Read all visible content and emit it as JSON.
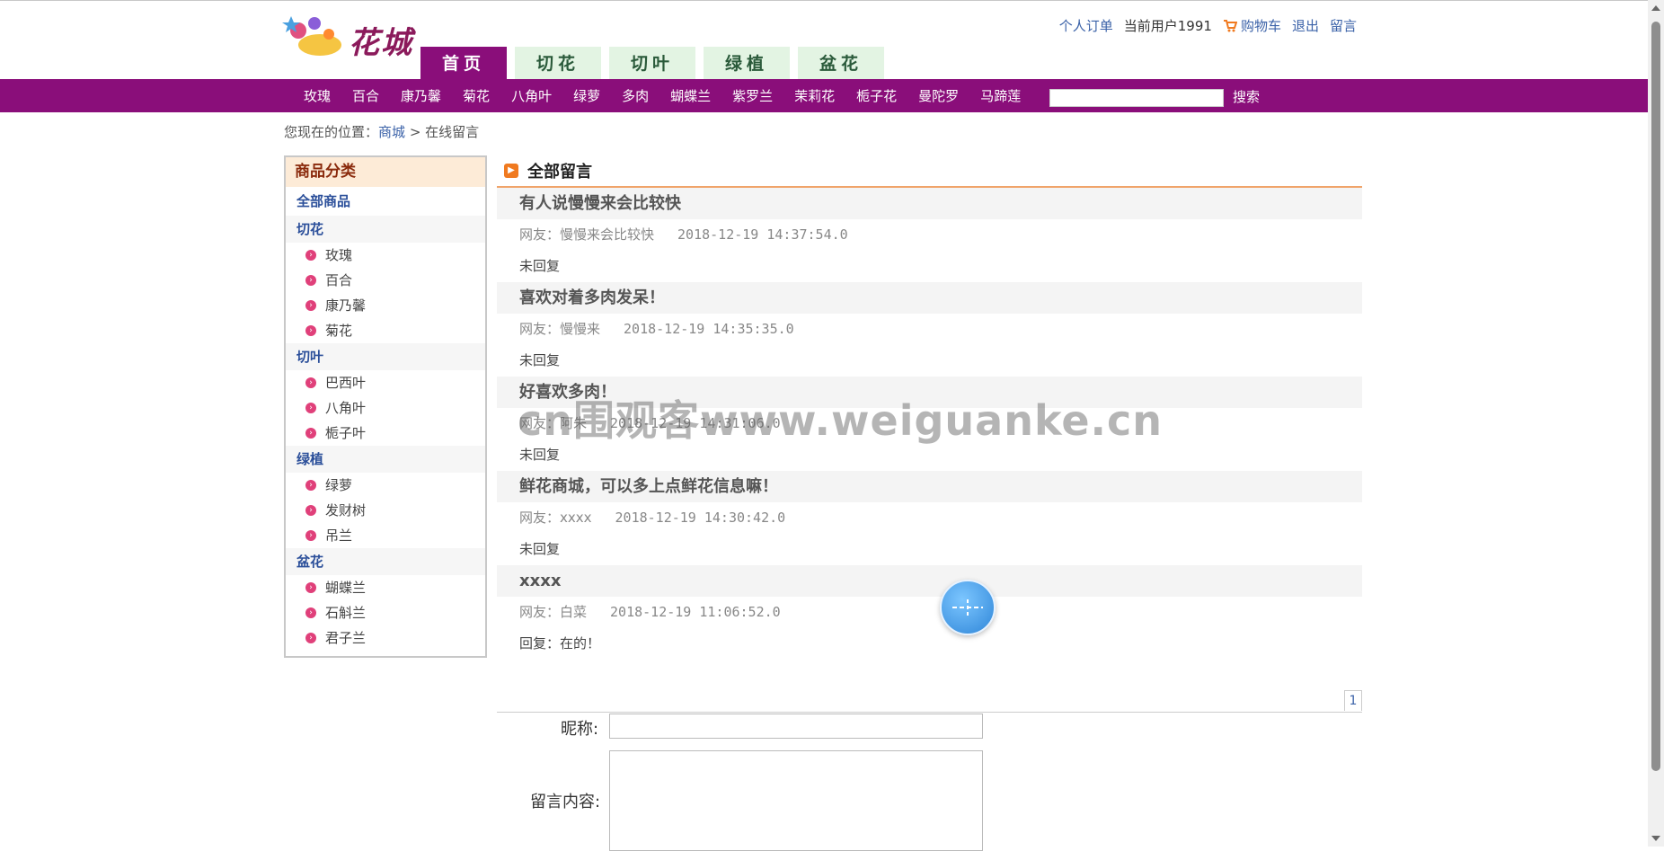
{
  "logo": {
    "text": "花城"
  },
  "userbar": {
    "orders": "个人订单",
    "current_user": "当前用户1991",
    "cart": "购物车",
    "logout": "退出",
    "message": "留言"
  },
  "nav_tabs": [
    {
      "label": "首页",
      "active": true
    },
    {
      "label": "切花",
      "active": false
    },
    {
      "label": "切叶",
      "active": false
    },
    {
      "label": "绿植",
      "active": false
    },
    {
      "label": "盆花",
      "active": false
    }
  ],
  "category_nav": [
    "玫瑰",
    "百合",
    "康乃馨",
    "菊花",
    "八角叶",
    "绿萝",
    "多肉",
    "蝴蝶兰",
    "紫罗兰",
    "茉莉花",
    "栀子花",
    "曼陀罗",
    "马蹄莲"
  ],
  "search": {
    "button": "搜索",
    "value": ""
  },
  "breadcrumb": {
    "prefix": "您现在的位置：",
    "link": "商城",
    "separator": ">",
    "current": "在线留言"
  },
  "sidebar": {
    "title": "商品分类",
    "all": "全部商品",
    "groups": [
      {
        "name": "切花",
        "items": [
          "玫瑰",
          "百合",
          "康乃馨",
          "菊花"
        ]
      },
      {
        "name": "切叶",
        "items": [
          "巴西叶",
          "八角叶",
          "栀子叶"
        ]
      },
      {
        "name": "绿植",
        "items": [
          "绿萝",
          "发财树",
          "吊兰"
        ]
      },
      {
        "name": "盆花",
        "items": [
          "蝴蝶兰",
          "石斛兰",
          "君子兰"
        ]
      }
    ]
  },
  "main": {
    "title": "全部留言",
    "messages": [
      {
        "title": "有人说慢慢来会比较快",
        "user": "网友：慢慢来会比较快",
        "time": "2018-12-19 14:37:54.0",
        "reply": "未回复"
      },
      {
        "title": "喜欢对着多肉发呆！",
        "user": "网友：慢慢来",
        "time": "2018-12-19 14:35:35.0",
        "reply": "未回复"
      },
      {
        "title": "好喜欢多肉！",
        "user": "网友：阿朱",
        "time": "2018-12-19 14:31:06.0",
        "reply": "未回复"
      },
      {
        "title": "鲜花商城，可以多上点鲜花信息嘛！",
        "user": "网友：xxxx",
        "time": "2018-12-19 14:30:42.0",
        "reply": "未回复"
      },
      {
        "title": "xxxx",
        "user": "网友：白菜",
        "time": "2018-12-19 11:06:52.0",
        "reply": "回复：在的！"
      }
    ],
    "page": "1"
  },
  "form": {
    "nickname_label": "昵称:",
    "content_label": "留言内容:",
    "nickname_value": "",
    "content_value": ""
  },
  "watermark": "cn围观客www.weiguanke.cn",
  "colors": {
    "purple_bar": "#8a0e7a",
    "tab_bg": "#e3f4e3",
    "accent_orange": "#f07a20",
    "link_blue": "#3b62a8"
  }
}
